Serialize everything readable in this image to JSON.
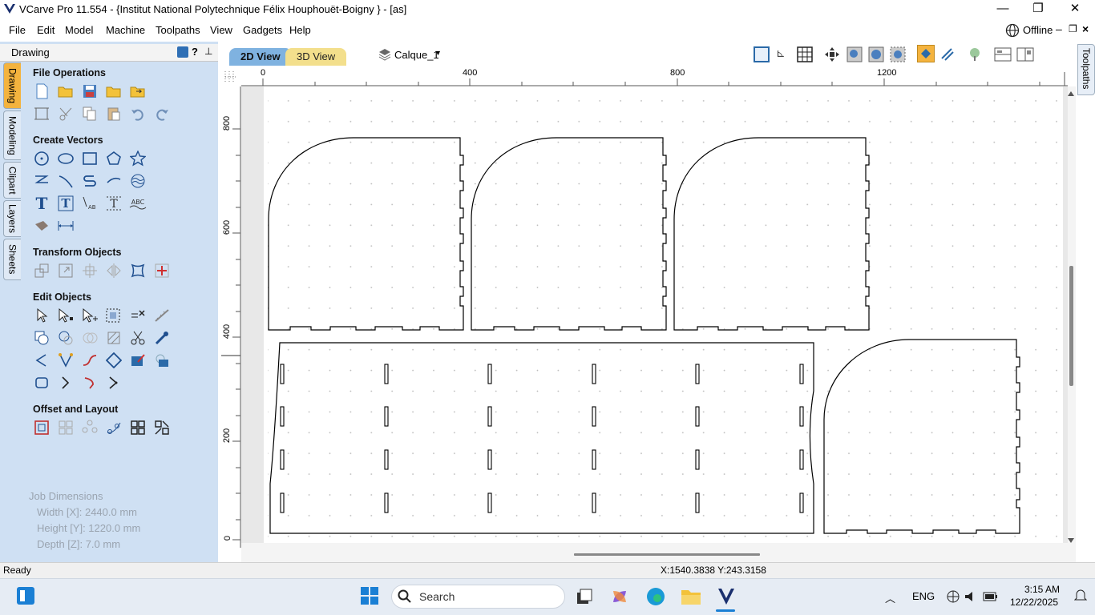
{
  "window": {
    "title": "VCarve Pro 11.554 - {Institut National Polytechnique Félix Houphouët-Boigny } - [as]",
    "minimize": "—",
    "maximize": "❐",
    "close": "✕"
  },
  "menu": {
    "items": [
      "File",
      "Edit",
      "Model",
      "Machine",
      "Toolpaths",
      "View",
      "Gadgets",
      "Help"
    ],
    "offline": "Offline"
  },
  "panel": {
    "title": "Drawing",
    "help": "?",
    "vtabs": [
      "Drawing",
      "Modeling",
      "Clipart",
      "Layers",
      "Sheets"
    ],
    "sections": {
      "file": "File Operations",
      "create": "Create Vectors",
      "transform": "Transform Objects",
      "edit": "Edit Objects",
      "offset": "Offset and Layout"
    },
    "job": {
      "heading": "Job Dimensions",
      "width": "Width  [X]: 2440.0 mm",
      "height": "Height [Y]: 1220.0 mm",
      "depth": "Depth  [Z]: 7.0 mm"
    }
  },
  "views": {
    "tab2d": "2D View",
    "tab3d": "3D View",
    "layer": "Calque_1"
  },
  "right_tab": "Toolpaths",
  "ruler": {
    "top": [
      "0",
      "400",
      "800",
      "1200"
    ],
    "left": [
      "800",
      "600",
      "400",
      "200",
      "0"
    ]
  },
  "status": {
    "ready": "Ready",
    "coords": "X:1540.3838 Y:243.3158"
  },
  "taskbar": {
    "search": "Search",
    "lang": "ENG",
    "time": "3:15 AM",
    "date": "12/22/2025"
  },
  "colors": {
    "accent": "#f4b33e",
    "panel": "#cfe0f3",
    "tab2d": "#7fb2e0",
    "tab3d": "#f3df8c"
  }
}
